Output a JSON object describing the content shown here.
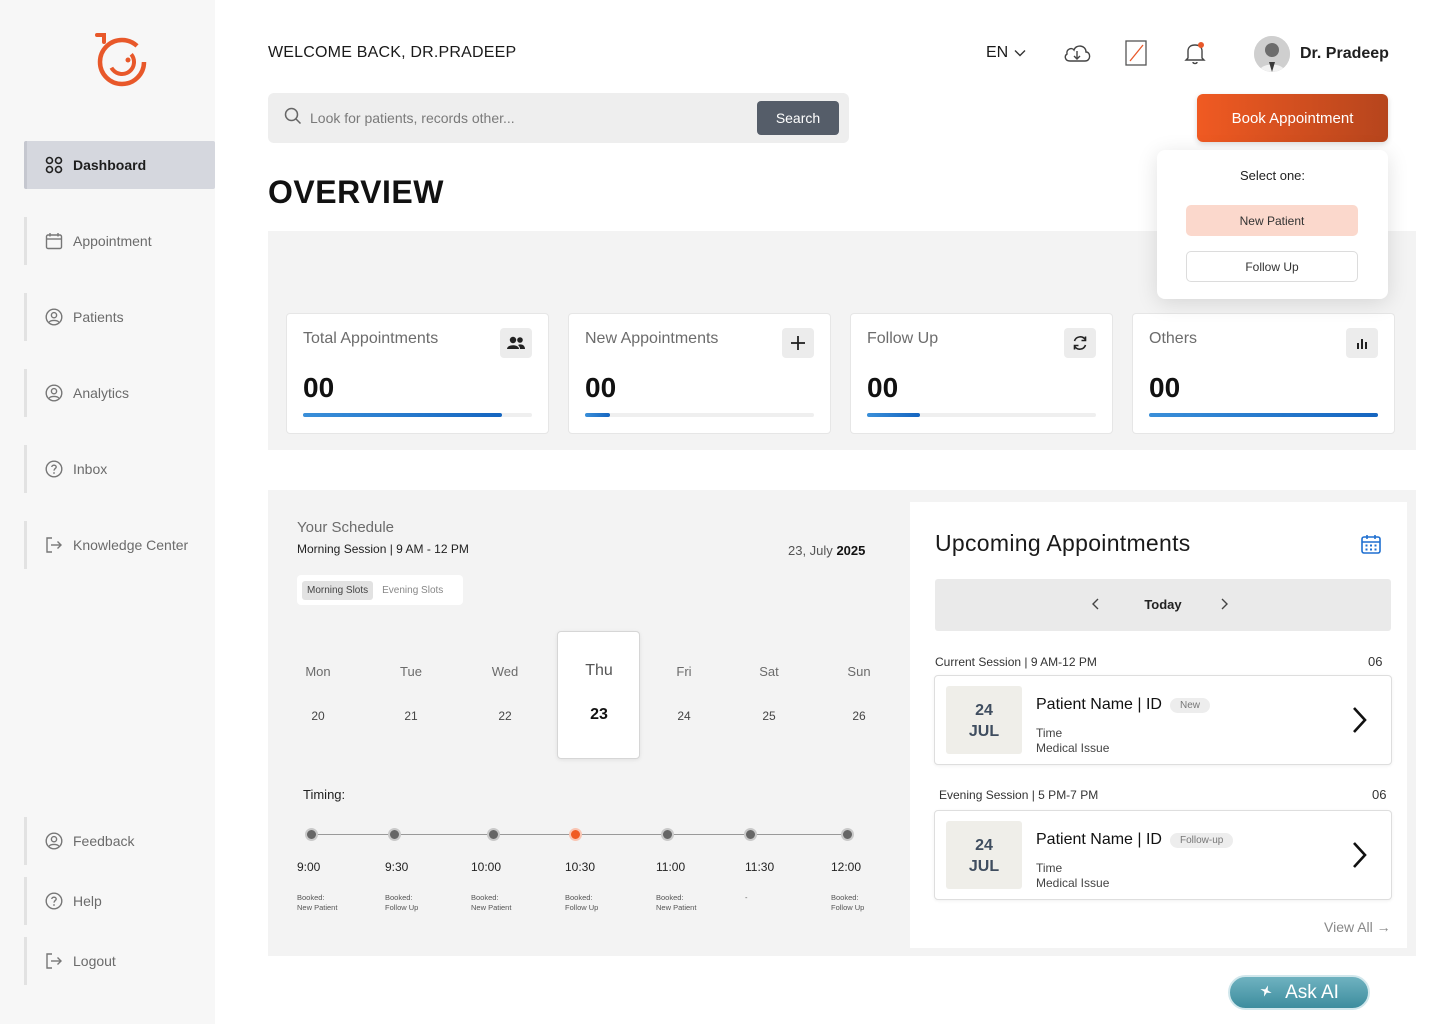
{
  "header": {
    "welcome": "WELCOME BACK, DR.PRADEEP",
    "language": "EN",
    "user_name": "Dr. Pradeep"
  },
  "sidebar": {
    "items": [
      {
        "label": "Dashboard",
        "icon": "grid-icon",
        "active": true
      },
      {
        "label": "Appointment",
        "icon": "calendar-icon"
      },
      {
        "label": "Patients",
        "icon": "user-circle-icon"
      },
      {
        "label": "Analytics",
        "icon": "user-circle-icon"
      },
      {
        "label": "Inbox",
        "icon": "help-circle-icon"
      },
      {
        "label": "Knowledge Center",
        "icon": "logout-icon"
      }
    ],
    "bottom_items": [
      {
        "label": "Feedback",
        "icon": "user-circle-icon"
      },
      {
        "label": "Help",
        "icon": "help-circle-icon"
      },
      {
        "label": "Logout",
        "icon": "logout-icon"
      }
    ]
  },
  "search": {
    "placeholder": "Look for patients, records other...",
    "button": "Search"
  },
  "book_button": "Book Appointment",
  "popup": {
    "title": "Select one:",
    "option_primary": "New Patient",
    "option_secondary": "Follow Up"
  },
  "overview_title": "OVERVIEW",
  "stats": [
    {
      "label": "Total Appointments",
      "value": "00",
      "progress": 0.87,
      "icon": "users-icon"
    },
    {
      "label": "New Appointments",
      "value": "00",
      "progress": 0.11,
      "icon": "plus-icon"
    },
    {
      "label": "Follow Up",
      "value": "00",
      "progress": 0.23,
      "icon": "refresh-icon"
    },
    {
      "label": "Others",
      "value": "00",
      "progress": 1.0,
      "icon": "bar-chart-icon"
    }
  ],
  "schedule": {
    "title": "Your Schedule",
    "session": "Morning Session | 9 AM - 12 PM",
    "date_prefix": "23, July",
    "date_year": "2025",
    "tabs": [
      "Morning Slots",
      "Evening Slots"
    ],
    "days": [
      {
        "name": "Mon",
        "num": "20"
      },
      {
        "name": "Tue",
        "num": "21"
      },
      {
        "name": "Wed",
        "num": "22"
      },
      {
        "name": "Thu",
        "num": "23",
        "active": true
      },
      {
        "name": "Fri",
        "num": "24"
      },
      {
        "name": "Sat",
        "num": "25"
      },
      {
        "name": "Sun",
        "num": "26"
      }
    ],
    "timing_label": "Timing:",
    "times": [
      {
        "time": "9:00",
        "booked_line1": "Booked:",
        "booked_line2": "New Patient"
      },
      {
        "time": "9:30",
        "booked_line1": "Booked:",
        "booked_line2": "Follow Up"
      },
      {
        "time": "10:00",
        "booked_line1": "Booked:",
        "booked_line2": "New Patient"
      },
      {
        "time": "10:30",
        "booked_line1": "Booked:",
        "booked_line2": "Follow Up",
        "active": true
      },
      {
        "time": "11:00",
        "booked_line1": "Booked:",
        "booked_line2": "New Patient"
      },
      {
        "time": "11:30",
        "booked_line1": "-",
        "booked_line2": ""
      },
      {
        "time": "12:00",
        "booked_line1": "Booked:",
        "booked_line2": "Follow Up"
      }
    ]
  },
  "upcoming": {
    "title": "Upcoming Appointments",
    "nav_label": "Today",
    "sessions": [
      {
        "label": "Current Session | 9 AM-12 PM",
        "count": "06",
        "day": "24",
        "month": "JUL",
        "patient": "Patient Name | ID",
        "tag": "New",
        "time": "Time",
        "issue": "Medical Issue"
      },
      {
        "label": "Evening Session | 5 PM-7 PM",
        "count": "06",
        "day": "24",
        "month": "JUL",
        "patient": "Patient Name | ID",
        "tag": "Follow-up",
        "time": "Time",
        "issue": "Medical Issue"
      }
    ],
    "view_all": "View All"
  },
  "ask_ai": "Ask AI",
  "colors": {
    "accent_orange": "#f05a22",
    "progress_blue": "#1565c0",
    "ask_ai_teal": "#4a9aab"
  }
}
